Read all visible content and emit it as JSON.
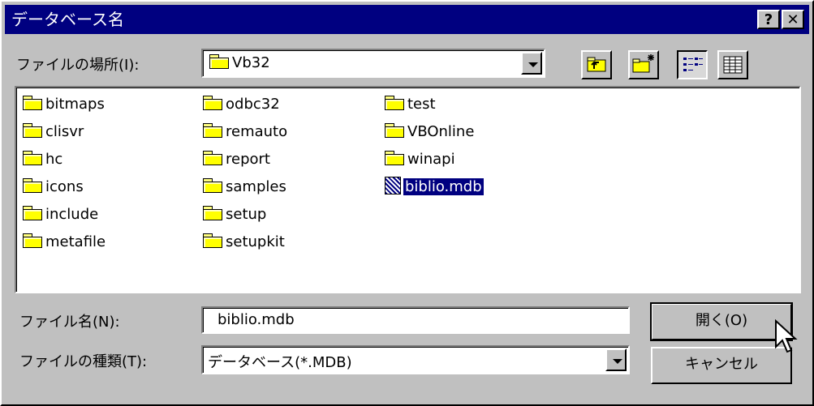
{
  "window": {
    "title": "データベース名",
    "help_label": "?",
    "close_label": "✕"
  },
  "look_in": {
    "label": "ファイルの場所(I):",
    "value": "Vb32"
  },
  "toolbar": {
    "icons": [
      "up-one-level-icon",
      "create-new-folder-icon",
      "list-view-icon",
      "details-view-icon"
    ]
  },
  "files": [
    {
      "name": "bitmaps",
      "type": "folder"
    },
    {
      "name": "clisvr",
      "type": "folder"
    },
    {
      "name": "hc",
      "type": "folder"
    },
    {
      "name": "icons",
      "type": "folder"
    },
    {
      "name": "include",
      "type": "folder"
    },
    {
      "name": "metafile",
      "type": "folder"
    },
    {
      "name": "odbc32",
      "type": "folder"
    },
    {
      "name": "remauto",
      "type": "folder"
    },
    {
      "name": "report",
      "type": "folder"
    },
    {
      "name": "samples",
      "type": "folder"
    },
    {
      "name": "setup",
      "type": "folder"
    },
    {
      "name": "setupkit",
      "type": "folder"
    },
    {
      "name": "test",
      "type": "folder"
    },
    {
      "name": "VBOnline",
      "type": "folder"
    },
    {
      "name": "winapi",
      "type": "folder"
    },
    {
      "name": "biblio.mdb",
      "type": "database",
      "selected": true
    }
  ],
  "filename": {
    "label": "ファイル名(N):",
    "value": "biblio.mdb"
  },
  "filetype": {
    "label": "ファイルの種類(T):",
    "value": "データベース(*.MDB)"
  },
  "buttons": {
    "open_label": "開く(O)",
    "cancel_label": "キャンセル"
  },
  "colors": {
    "titlebar": "#000080",
    "face": "#c0c0c0",
    "selection": "#000080"
  }
}
